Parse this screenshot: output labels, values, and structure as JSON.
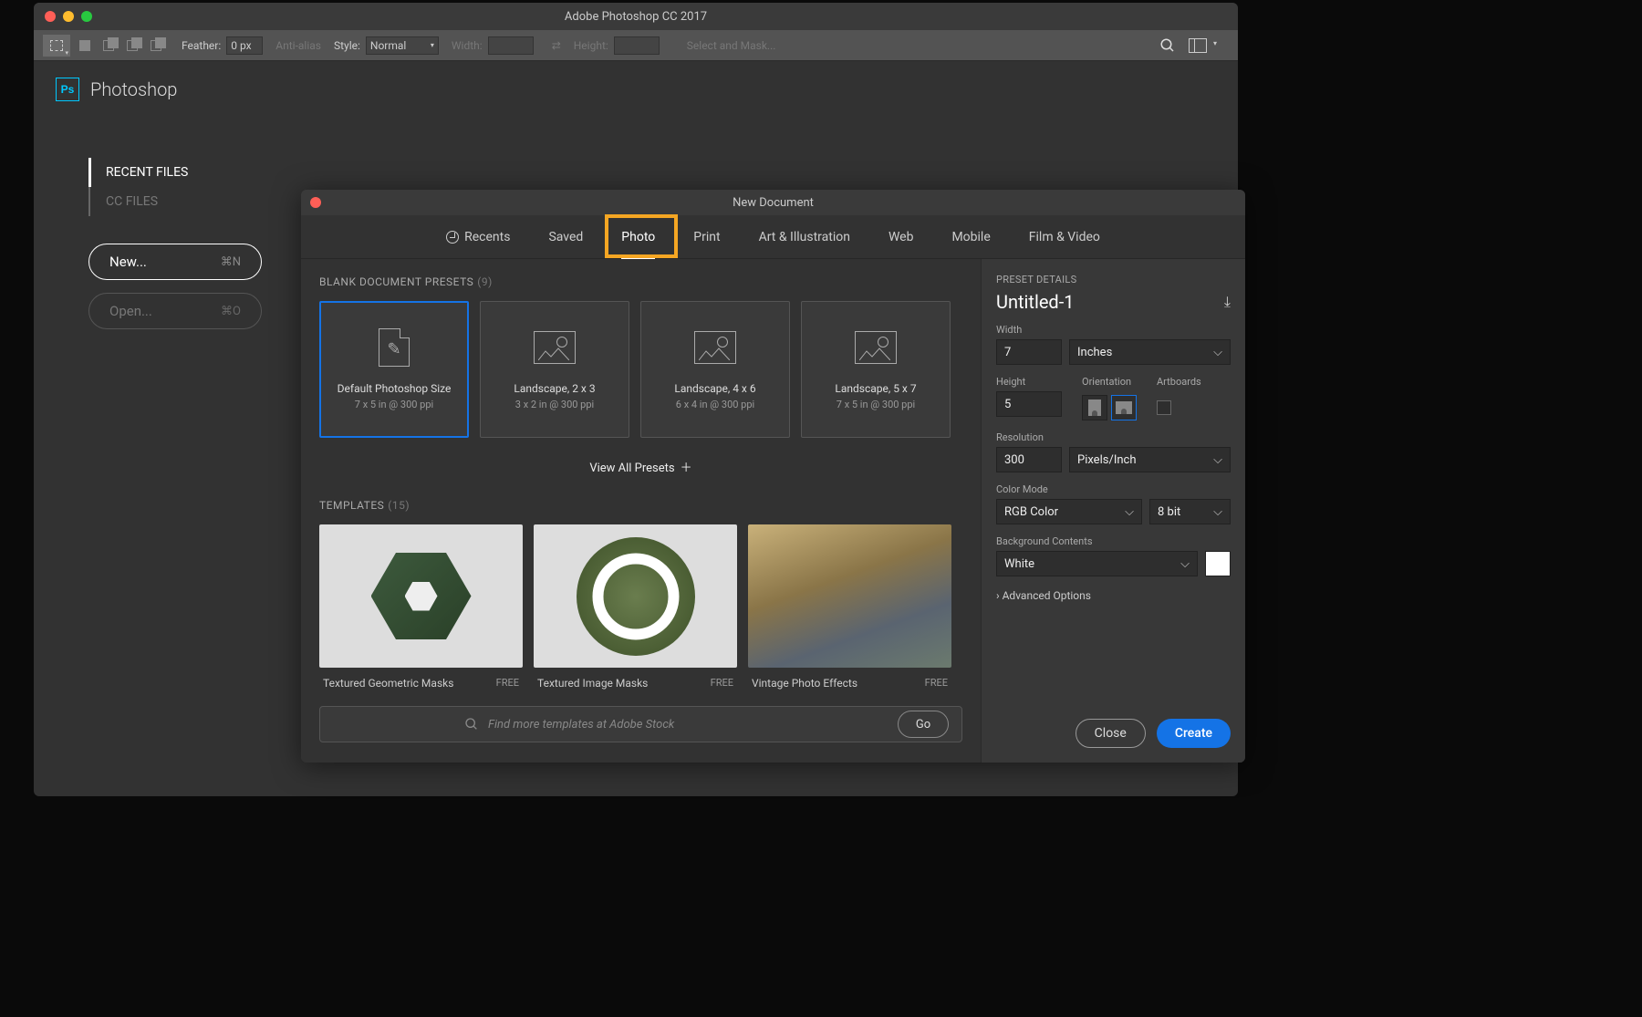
{
  "app": {
    "title": "Adobe Photoshop CC 2017",
    "brand": "Photoshop",
    "logo": "Ps"
  },
  "optionsBar": {
    "feather_label": "Feather:",
    "feather_value": "0 px",
    "antialias": "Anti-alias",
    "style_label": "Style:",
    "style_value": "Normal",
    "width_label": "Width:",
    "height_label": "Height:",
    "selectmask": "Select and Mask..."
  },
  "sidebar": {
    "tabs": [
      "RECENT FILES",
      "CC FILES"
    ],
    "buttons": [
      {
        "label": "New...",
        "shortcut": "⌘N"
      },
      {
        "label": "Open...",
        "shortcut": "⌘O"
      }
    ]
  },
  "modal": {
    "title": "New Document",
    "tabs": [
      "Recents",
      "Saved",
      "Photo",
      "Print",
      "Art & Illustration",
      "Web",
      "Mobile",
      "Film & Video"
    ],
    "section": {
      "label": "BLANK DOCUMENT PRESETS",
      "count": "(9)"
    },
    "presets": [
      {
        "name": "Default Photoshop Size",
        "sub": "7 x 5 in @ 300 ppi"
      },
      {
        "name": "Landscape, 2 x 3",
        "sub": "3 x 2 in @ 300 ppi"
      },
      {
        "name": "Landscape, 4 x 6",
        "sub": "6 x 4 in @ 300 ppi"
      },
      {
        "name": "Landscape, 5 x 7",
        "sub": "7 x 5 in @ 300 ppi"
      }
    ],
    "view_all": "View All Presets",
    "templates_section": {
      "label": "TEMPLATES",
      "count": "(15)"
    },
    "templates": [
      {
        "name": "Textured Geometric Masks",
        "price": "FREE"
      },
      {
        "name": "Textured Image Masks",
        "price": "FREE"
      },
      {
        "name": "Vintage Photo Effects",
        "price": "FREE"
      }
    ],
    "search_placeholder": "Find more templates at Adobe Stock",
    "go": "Go"
  },
  "details": {
    "header": "PRESET DETAILS",
    "name": "Untitled-1",
    "width_label": "Width",
    "width": "7",
    "width_unit": "Inches",
    "height_label": "Height",
    "height": "5",
    "orientation_label": "Orientation",
    "artboards_label": "Artboards",
    "resolution_label": "Resolution",
    "resolution": "300",
    "resolution_unit": "Pixels/Inch",
    "colormode_label": "Color Mode",
    "colormode": "RGB Color",
    "bitdepth": "8 bit",
    "bg_label": "Background Contents",
    "bg": "White",
    "advanced": "Advanced Options",
    "close": "Close",
    "create": "Create"
  }
}
